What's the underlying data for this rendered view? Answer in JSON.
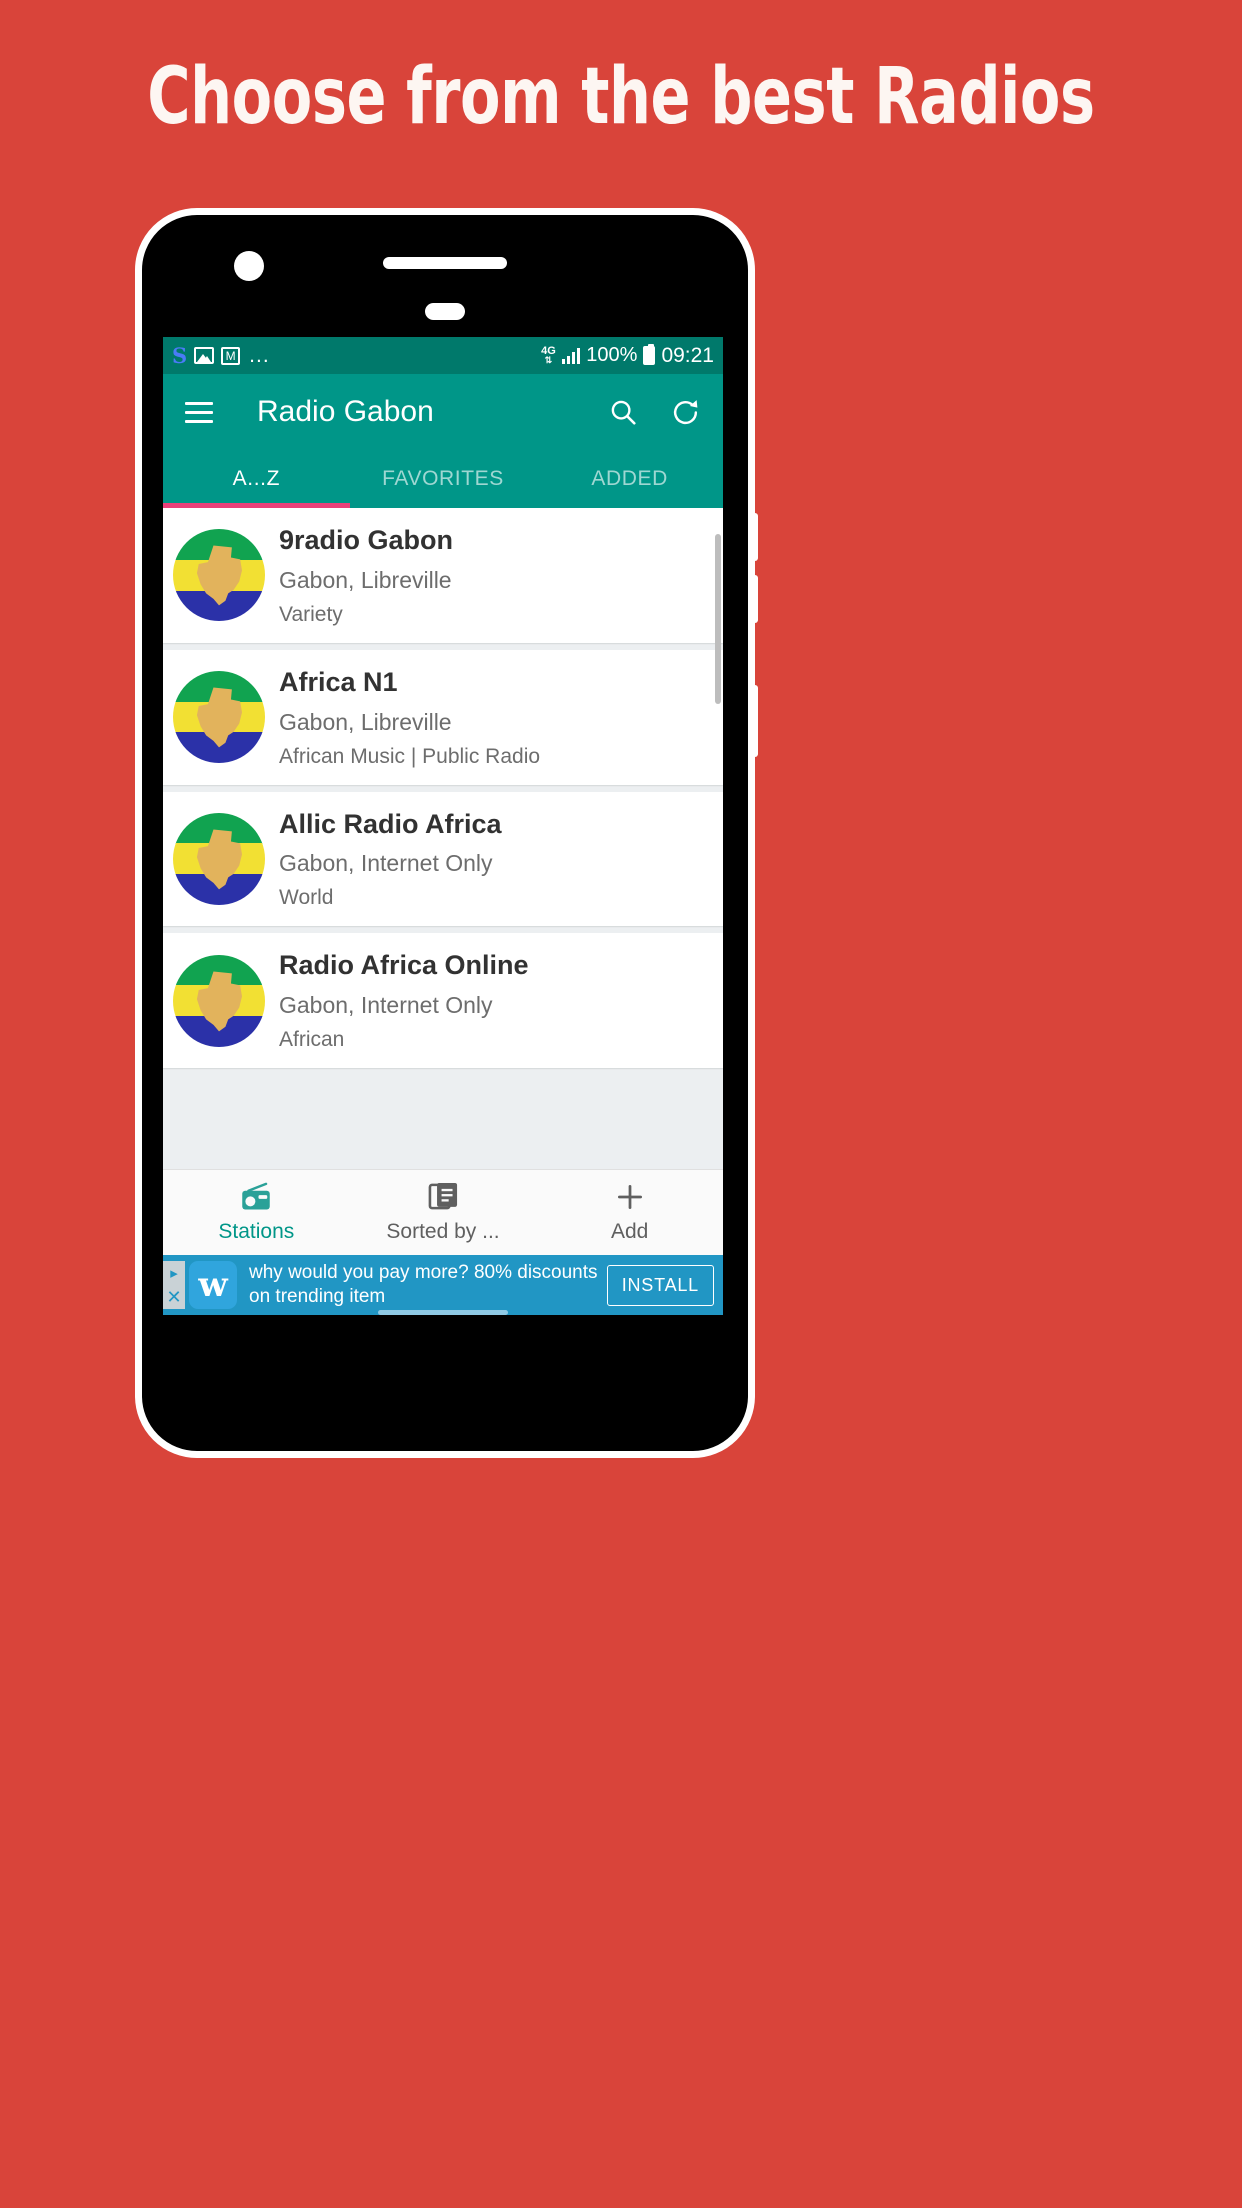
{
  "promo": {
    "headline": "Choose from the best Radios",
    "background_color": "#d9443a"
  },
  "status_bar": {
    "app_icons": [
      "skype-icon",
      "photos-icon",
      "gmail-icon"
    ],
    "overflow": "...",
    "network": "4G",
    "battery_percent": "100%",
    "time": "09:21"
  },
  "toolbar": {
    "menu_icon": "hamburger-menu-icon",
    "title": "Radio Gabon",
    "search_icon": "search-icon",
    "refresh_icon": "refresh-icon",
    "background_color": "#009688"
  },
  "tabs": {
    "items": [
      {
        "label": "A...Z",
        "active": true
      },
      {
        "label": "FAVORITES",
        "active": false
      },
      {
        "label": "ADDED",
        "active": false
      }
    ],
    "indicator_color": "#ec407a"
  },
  "stations": [
    {
      "name": "9radio Gabon",
      "location": "Gabon, Libreville",
      "genre": "Variety"
    },
    {
      "name": "Africa N1",
      "location": "Gabon, Libreville",
      "genre": "African Music | Public Radio"
    },
    {
      "name": "Allic Radio Africa",
      "location": "Gabon, Internet Only",
      "genre": "World"
    },
    {
      "name": "Radio Africa Online",
      "location": "Gabon, Internet Only",
      "genre": "African"
    }
  ],
  "bottom_nav": [
    {
      "label": "Stations",
      "icon": "radio-icon",
      "active": true
    },
    {
      "label": "Sorted by ...",
      "icon": "list-document-icon",
      "active": false
    },
    {
      "label": "Add",
      "icon": "plus-icon",
      "active": false
    }
  ],
  "ad": {
    "logo_letter": "w",
    "text": "why would you pay more? 80% discounts on trending item",
    "cta": "INSTALL",
    "adchoices_icon": "adchoices-icon",
    "close_icon": "close-icon",
    "background_color": "#2196c4"
  }
}
